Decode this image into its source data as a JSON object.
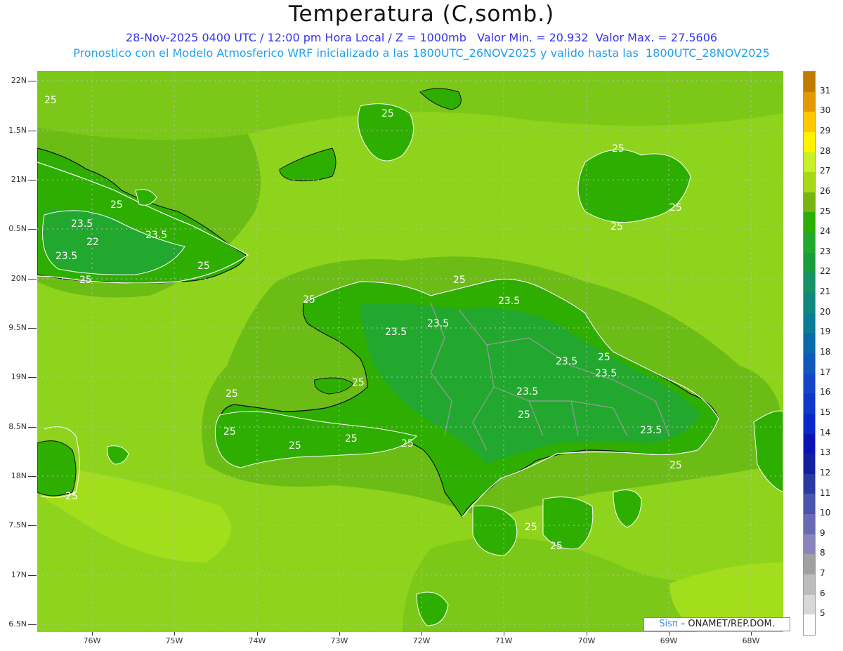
{
  "title": "Temperatura (C,somb.)",
  "subtitle_line1": "28-Nov-2025 0400 UTC / 12:00 pm Hora Local / Z = 1000mb   Valor Min. = 20.932  Valor Max. = 27.5606",
  "subtitle_line2": "Pronostico con el Modelo Atmosferico WRF inicializado a las 1800UTC_26NOV2025 y valido hasta las  1800UTC_28NOV2025",
  "y_axis_labels": [
    "22N",
    "1.5N",
    "21N",
    "0.5N",
    "20N",
    "9.5N",
    "19N",
    "8.5N",
    "18N",
    "7.5N",
    "17N",
    "6.5N"
  ],
  "x_axis_labels": [
    "76W",
    "75W",
    "74W",
    "73W",
    "72W",
    "71W",
    "70W",
    "69W",
    "68W"
  ],
  "colorbar_labels": [
    "31",
    "30",
    "29",
    "28",
    "27",
    "26",
    "25",
    "24",
    "23",
    "22",
    "21",
    "20",
    "19",
    "18",
    "17",
    "16",
    "15",
    "14",
    "13",
    "12",
    "11",
    "10",
    "9",
    "8",
    "7",
    "6",
    "5"
  ],
  "colorbar_colors": [
    "#c07a00",
    "#e39a00",
    "#ffc800",
    "#fff200",
    "#c8f028",
    "#a8d818",
    "#78b410",
    "#2eae00",
    "#22a82e",
    "#1a9c3c",
    "#189068",
    "#10887e",
    "#0a7c96",
    "#0b6aa8",
    "#1058be",
    "#1446c8",
    "#1038c8",
    "#0a28c8",
    "#0a14b4",
    "#1420a0",
    "#2a3aa0",
    "#4a54aa",
    "#6a6ab4",
    "#8a86bc",
    "#a0a0a0",
    "#bcbcbc",
    "#d8d8d8",
    "#ffffff"
  ],
  "contour_labels": [
    "25",
    "25",
    "25",
    "23.5",
    "22",
    "23.5",
    "23.5",
    "25",
    "25",
    "25",
    "25",
    "25",
    "25",
    "23.5",
    "25",
    "23.5",
    "23.5",
    "25",
    "25",
    "25",
    "25",
    "23.5",
    "25",
    "23.5",
    "23.5",
    "23.5",
    "25",
    "25",
    "25",
    "25",
    "25",
    "25",
    "25"
  ],
  "credit": {
    "brand": "Sisπ",
    "text": " – ONAMET/REP.DOM."
  }
}
